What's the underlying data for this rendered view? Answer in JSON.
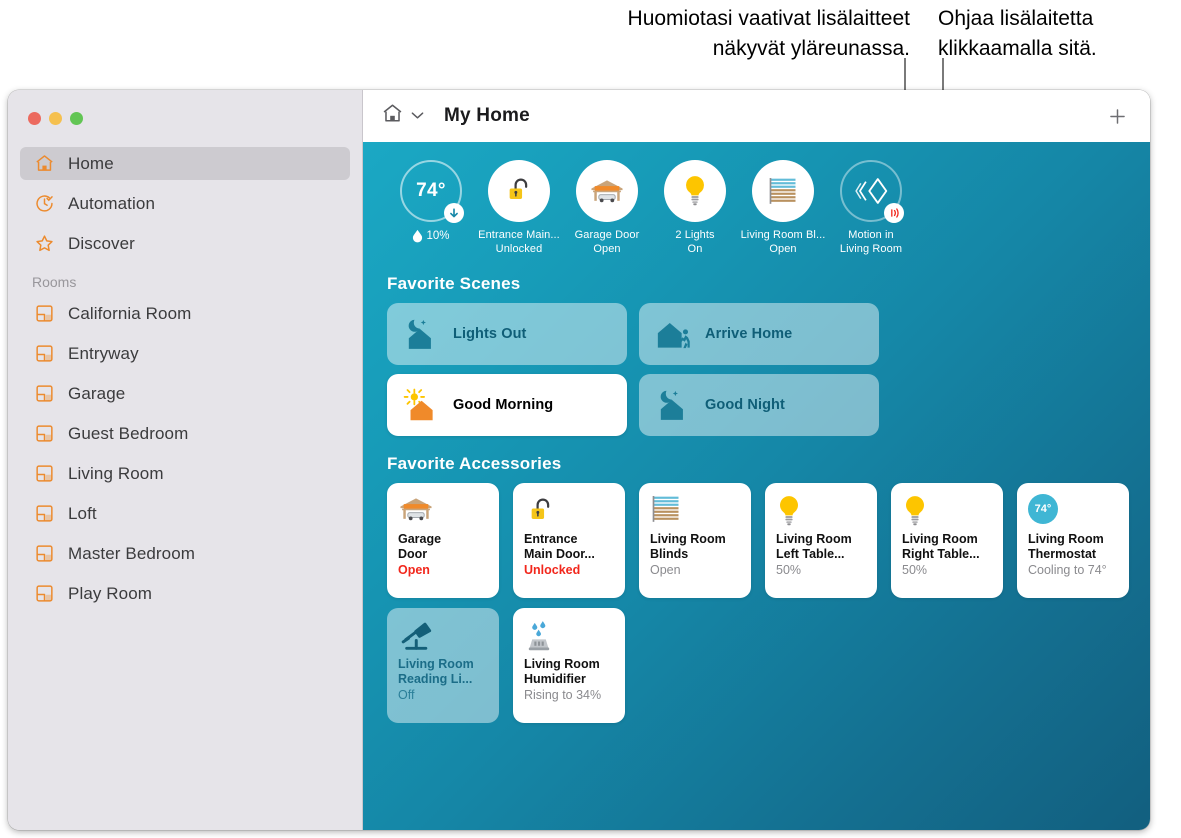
{
  "callouts": {
    "left": "Huomiotasi vaativat lisälaitteet\nnäkyvät yläreunassa.",
    "right": "Ohjaa lisälaitetta\nklikkaamalla sitä."
  },
  "window": {
    "traffic_lights": [
      "close",
      "minimize",
      "zoom"
    ]
  },
  "sidebar": {
    "nav": [
      {
        "label": "Home",
        "icon": "home-icon",
        "selected": true
      },
      {
        "label": "Automation",
        "icon": "automation-clock-icon",
        "selected": false
      },
      {
        "label": "Discover",
        "icon": "star-icon",
        "selected": false
      }
    ],
    "rooms_header": "Rooms",
    "rooms": [
      {
        "label": "California Room",
        "icon": "room-icon"
      },
      {
        "label": "Entryway",
        "icon": "room-icon"
      },
      {
        "label": "Garage",
        "icon": "room-icon"
      },
      {
        "label": "Guest Bedroom",
        "icon": "room-icon"
      },
      {
        "label": "Living Room",
        "icon": "room-icon"
      },
      {
        "label": "Loft",
        "icon": "room-icon"
      },
      {
        "label": "Master Bedroom",
        "icon": "room-icon"
      },
      {
        "label": "Play Room",
        "icon": "room-icon"
      }
    ]
  },
  "toolbar": {
    "home_icon": "home-icon",
    "chevron_icon": "chevron-down-icon",
    "title": "My Home",
    "add_icon": "plus-icon"
  },
  "status_strip": [
    {
      "kind": "temperature",
      "value": "74°",
      "humidity": "10%",
      "humidity_icon": "water-drop-icon",
      "badge_icon": "arrow-down-icon",
      "icon": "thermostat-ring-icon"
    },
    {
      "kind": "accessory",
      "icon": "unlocked-padlock-icon",
      "name": "Entrance Main...",
      "state": "Unlocked"
    },
    {
      "kind": "accessory",
      "icon": "garage-door-icon",
      "name": "Garage Door",
      "state": "Open"
    },
    {
      "kind": "accessory",
      "icon": "lightbulb-icon",
      "name": "2 Lights",
      "state": "On"
    },
    {
      "kind": "accessory",
      "icon": "blinds-icon",
      "name": "Living Room Bl...",
      "state": "Open"
    },
    {
      "kind": "sensor",
      "icon": "motion-sensor-icon",
      "badge_icon": "motion-waves-icon",
      "name": "Motion in",
      "state": "Living Room"
    }
  ],
  "scenes_section": {
    "title": "Favorite Scenes",
    "items": [
      {
        "label": "Lights Out",
        "icon": "moon-house-icon",
        "active": false
      },
      {
        "label": "Arrive Home",
        "icon": "house-person-icon",
        "active": false
      },
      {
        "label": "Good Morning",
        "icon": "sun-house-icon",
        "active": true
      },
      {
        "label": "Good Night",
        "icon": "moon-house-icon",
        "active": false
      }
    ]
  },
  "accessories_section": {
    "title": "Favorite Accessories",
    "items": [
      {
        "name": "Garage\nDoor",
        "state": "Open",
        "state_style": "red",
        "icon": "garage-door-icon",
        "on": true
      },
      {
        "name": "Entrance\nMain Door...",
        "state": "Unlocked",
        "state_style": "red",
        "icon": "unlocked-padlock-icon",
        "on": true
      },
      {
        "name": "Living Room\nBlinds",
        "state": "Open",
        "state_style": "grey",
        "icon": "blinds-icon",
        "on": true
      },
      {
        "name": "Living Room\nLeft Table...",
        "state": "50%",
        "state_style": "grey",
        "icon": "lightbulb-icon",
        "on": true
      },
      {
        "name": "Living Room\nRight Table...",
        "state": "50%",
        "state_style": "grey",
        "icon": "lightbulb-icon",
        "on": true
      },
      {
        "name": "Living Room\nThermostat",
        "state": "Cooling to 74°",
        "state_style": "grey",
        "icon": "thermostat-bubble-icon",
        "on": true,
        "bubble_value": "74°"
      },
      {
        "name": "Living Room\nReading Li...",
        "state": "Off",
        "state_style": "off",
        "icon": "desk-lamp-icon",
        "on": false
      },
      {
        "name": "Living Room\nHumidifier",
        "state": "Rising to 34%",
        "state_style": "grey",
        "icon": "humidifier-icon",
        "on": true
      }
    ]
  },
  "colors": {
    "accent_orange": "#ec8b2f",
    "canvas_teal_light": "#1ba8c4",
    "canvas_teal_dark": "#125f7f",
    "alert_red": "#f2271c",
    "sidebar_bg": "#e6e4e9",
    "scene_label_teal": "#0f5e77"
  }
}
